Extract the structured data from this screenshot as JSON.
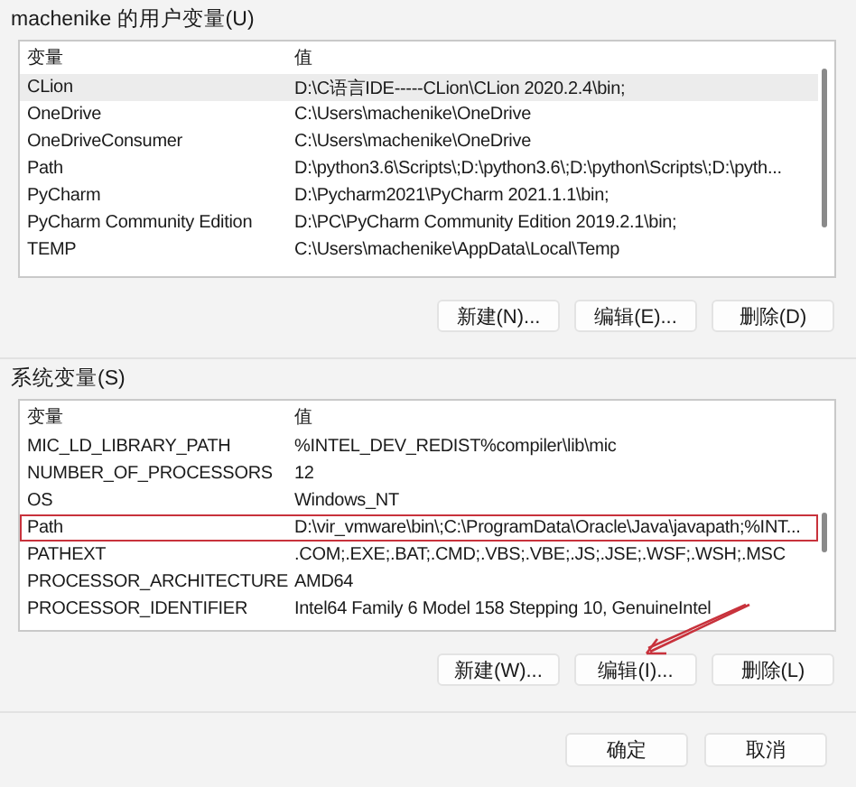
{
  "user_vars": {
    "title": "machenike 的用户变量(U)",
    "columns": [
      "变量",
      "值"
    ],
    "rows": [
      {
        "name": "CLion",
        "value": "D:\\C语言IDE-----CLion\\CLion 2020.2.4\\bin;",
        "selected": true,
        "outlined": false
      },
      {
        "name": "OneDrive",
        "value": "C:\\Users\\machenike\\OneDrive",
        "selected": false,
        "outlined": false
      },
      {
        "name": "OneDriveConsumer",
        "value": "C:\\Users\\machenike\\OneDrive",
        "selected": false,
        "outlined": false
      },
      {
        "name": "Path",
        "value": "D:\\python3.6\\Scripts\\;D:\\python3.6\\;D:\\python\\Scripts\\;D:\\pyth...",
        "selected": false,
        "outlined": false
      },
      {
        "name": "PyCharm",
        "value": "D:\\Pycharm2021\\PyCharm 2021.1.1\\bin;",
        "selected": false,
        "outlined": false
      },
      {
        "name": "PyCharm Community Edition",
        "value": "D:\\PC\\PyCharm Community Edition 2019.2.1\\bin;",
        "selected": false,
        "outlined": false
      },
      {
        "name": "TEMP",
        "value": "C:\\Users\\machenike\\AppData\\Local\\Temp",
        "selected": false,
        "outlined": false
      }
    ],
    "buttons": [
      "新建(N)...",
      "编辑(E)...",
      "删除(D)"
    ]
  },
  "system_vars": {
    "title": "系统变量(S)",
    "columns": [
      "变量",
      "值"
    ],
    "rows": [
      {
        "name": "MIC_LD_LIBRARY_PATH",
        "value": "%INTEL_DEV_REDIST%compiler\\lib\\mic",
        "selected": false,
        "outlined": false
      },
      {
        "name": "NUMBER_OF_PROCESSORS",
        "value": "12",
        "selected": false,
        "outlined": false
      },
      {
        "name": "OS",
        "value": "Windows_NT",
        "selected": false,
        "outlined": false
      },
      {
        "name": "Path",
        "value": "D:\\vir_vmware\\bin\\;C:\\ProgramData\\Oracle\\Java\\javapath;%INT...",
        "selected": false,
        "outlined": true
      },
      {
        "name": "PATHEXT",
        "value": ".COM;.EXE;.BAT;.CMD;.VBS;.VBE;.JS;.JSE;.WSF;.WSH;.MSC",
        "selected": false,
        "outlined": false
      },
      {
        "name": "PROCESSOR_ARCHITECTURE",
        "value": "AMD64",
        "selected": false,
        "outlined": false
      },
      {
        "name": "PROCESSOR_IDENTIFIER",
        "value": "Intel64 Family 6 Model 158 Stepping 10, GenuineIntel",
        "selected": false,
        "outlined": false
      }
    ],
    "buttons": [
      "新建(W)...",
      "编辑(I)...",
      "删除(L)"
    ]
  },
  "annotation_arrow": true,
  "footer_buttons": [
    "确定",
    "取消"
  ]
}
